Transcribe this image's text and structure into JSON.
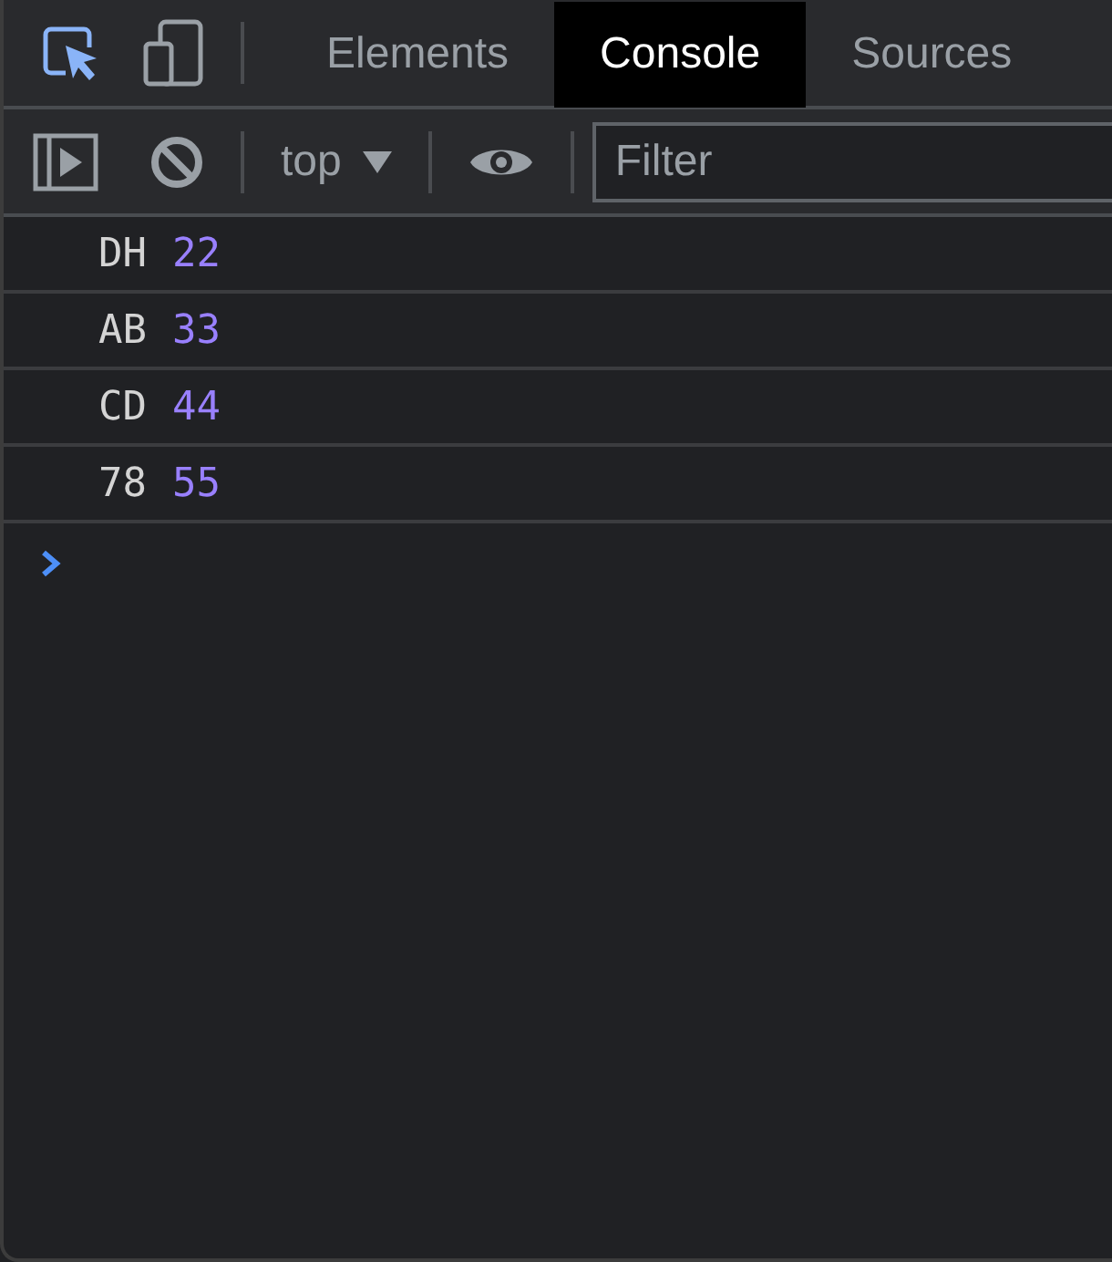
{
  "tabs": [
    {
      "label": "Elements",
      "selected": false
    },
    {
      "label": "Console",
      "selected": true
    },
    {
      "label": "Sources",
      "selected": false
    }
  ],
  "toolbar": {
    "context": "top",
    "filter": {
      "placeholder": "Filter"
    }
  },
  "messages": [
    {
      "label": "DH",
      "value": "22"
    },
    {
      "label": "AB",
      "value": "33"
    },
    {
      "label": "CD",
      "value": "44"
    },
    {
      "label": "78",
      "value": "55"
    }
  ]
}
